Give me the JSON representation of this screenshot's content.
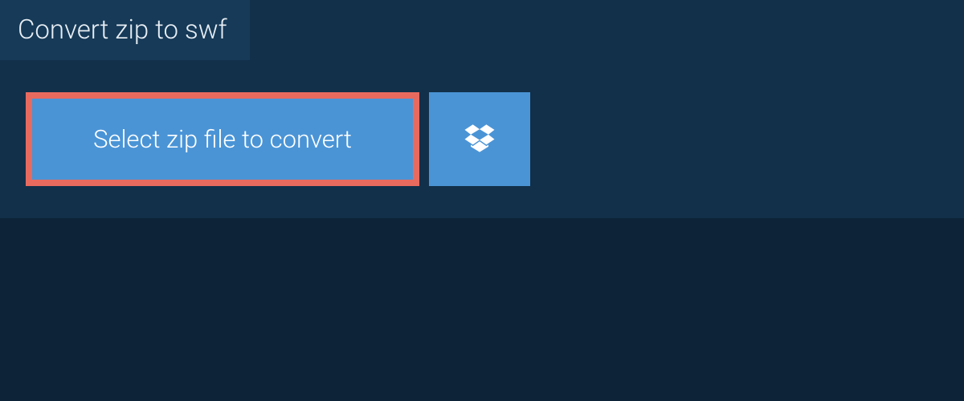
{
  "tab": {
    "title": "Convert zip to swf"
  },
  "actions": {
    "select_file_label": "Select zip file to convert"
  },
  "colors": {
    "bg": "#0d2438",
    "panel": "#12304a",
    "tab": "#163a58",
    "button": "#4a94d6",
    "highlight_border": "#e86a5f",
    "text": "#ffffff"
  }
}
